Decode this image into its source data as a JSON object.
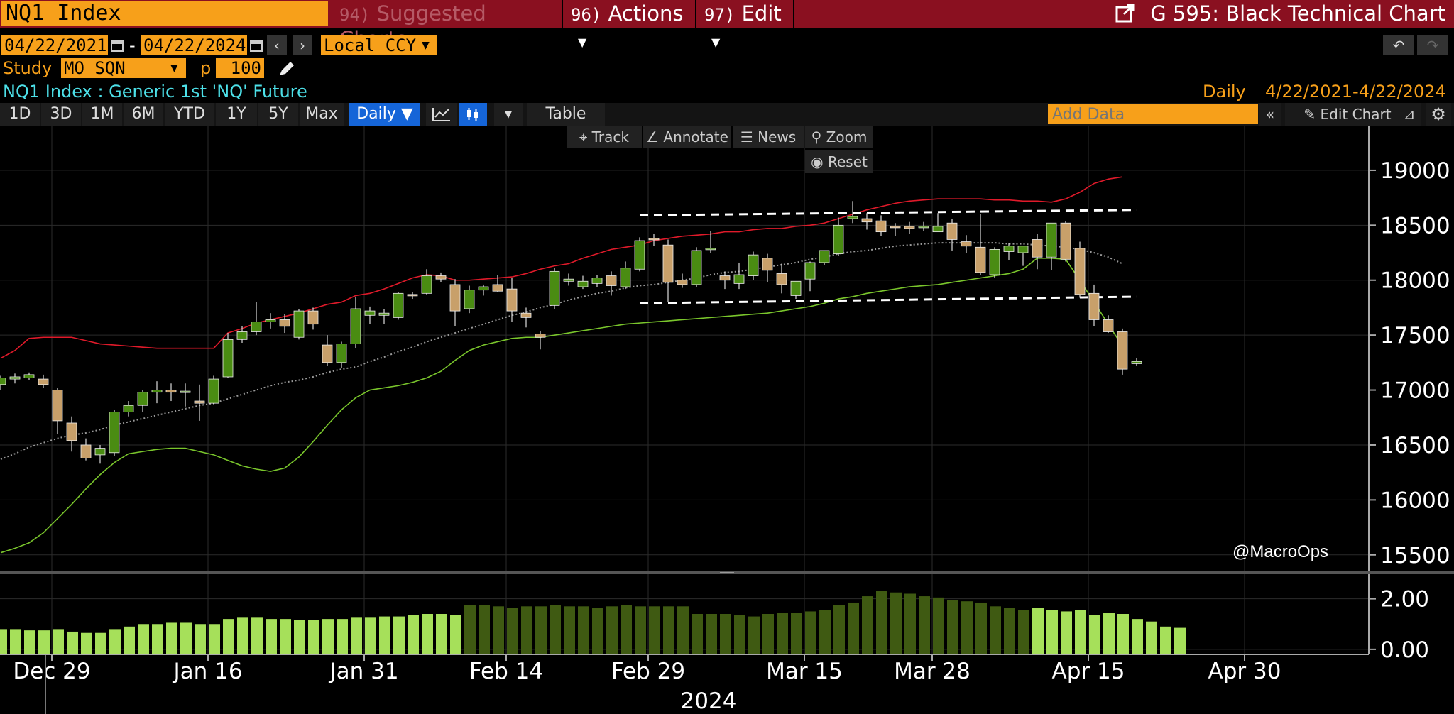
{
  "header": {
    "ticker_value": "NQ1 Index",
    "menu_suggested_num": "94)",
    "menu_suggested": "Suggested Charts",
    "menu_actions_num": "96)",
    "menu_actions": "Actions",
    "menu_edit_num": "97)",
    "menu_edit": "Edit",
    "chart_name": "G 595: Black Technical Chart"
  },
  "range": {
    "start": "04/22/2021",
    "dash": "-",
    "end": "04/22/2024",
    "currency": "Local CCY"
  },
  "study": {
    "label": "Study",
    "value": "MO SQN",
    "p_label": "p",
    "p_value": "100"
  },
  "security": {
    "desc": "NQ1 Index : Generic 1st 'NQ' Future",
    "freq": "Daily",
    "dates": "4/22/2021-4/22/2024"
  },
  "toolbar": {
    "periods": [
      "1D",
      "3D",
      "1M",
      "6M",
      "YTD",
      "1Y",
      "5Y",
      "Max"
    ],
    "frequency": "Daily ▼",
    "table": "Table",
    "add_data_placeholder": "Add Data",
    "edit_chart": "Edit Chart"
  },
  "chart_tools": {
    "track": "Track",
    "annotate": "Annotate",
    "news": "News",
    "zoom": "Zoom",
    "reset": "Reset"
  },
  "watermark": "@MacroOps",
  "colors": {
    "up": "#4a8c12",
    "down": "#c8a06a",
    "upper_band": "#e01a2a",
    "lower_band": "#7ac62c",
    "midline": "#9a9a9a",
    "volume_bright": "#a6e05a",
    "volume_dark": "#3f5a12",
    "accent": "#f7a01a",
    "bar": "#8a1020"
  },
  "chart_data": {
    "type": "candlestick",
    "price_axis": {
      "ylim": [
        15350,
        19400
      ],
      "ticks": [
        15500,
        16000,
        16500,
        17000,
        17500,
        18000,
        18500,
        19000
      ]
    },
    "sqn_axis": {
      "ylim": [
        -0.2,
        3.0
      ],
      "ticks": [
        "0.00",
        "2.00"
      ],
      "tick_values": [
        0,
        2
      ]
    },
    "x_ticks": [
      {
        "label": "Dec 29",
        "index": 1
      },
      {
        "label": "Jan 16",
        "index": 12
      },
      {
        "label": "Jan 31",
        "index": 23
      },
      {
        "label": "Feb 14",
        "index": 33
      },
      {
        "label": "Feb 29",
        "index": 43
      },
      {
        "label": "Mar 15",
        "index": 54
      },
      {
        "label": "Mar 28",
        "index": 63
      },
      {
        "label": "Apr 15",
        "index": 74
      },
      {
        "label": "Apr 30",
        "index": 85
      }
    ],
    "year_label": "2024",
    "ohlc": [
      [
        17050,
        17130,
        17000,
        17110
      ],
      [
        17100,
        17150,
        17060,
        17120
      ],
      [
        17110,
        17160,
        17090,
        17140
      ],
      [
        17100,
        17140,
        17020,
        17050
      ],
      [
        17000,
        17020,
        16600,
        16720
      ],
      [
        16700,
        16760,
        16440,
        16540
      ],
      [
        16500,
        16560,
        16360,
        16380
      ],
      [
        16410,
        16500,
        16330,
        16470
      ],
      [
        16430,
        16820,
        16400,
        16800
      ],
      [
        16800,
        16900,
        16760,
        16860
      ],
      [
        16860,
        17000,
        16800,
        16980
      ],
      [
        16980,
        17080,
        16880,
        17000
      ],
      [
        17000,
        17060,
        16900,
        16980
      ],
      [
        16990,
        17060,
        16850,
        16990
      ],
      [
        16900,
        17050,
        16720,
        16880
      ],
      [
        16880,
        17130,
        16870,
        17100
      ],
      [
        17120,
        17520,
        17110,
        17460
      ],
      [
        17460,
        17580,
        17430,
        17530
      ],
      [
        17530,
        17800,
        17500,
        17620
      ],
      [
        17620,
        17700,
        17560,
        17640
      ],
      [
        17640,
        17690,
        17520,
        17580
      ],
      [
        17480,
        17740,
        17460,
        17720
      ],
      [
        17720,
        17750,
        17550,
        17600
      ],
      [
        17410,
        17500,
        17220,
        17250
      ],
      [
        17250,
        17440,
        17200,
        17420
      ],
      [
        17420,
        17850,
        17380,
        17740
      ],
      [
        17680,
        17760,
        17600,
        17720
      ],
      [
        17680,
        17740,
        17600,
        17700
      ],
      [
        17660,
        17890,
        17640,
        17880
      ],
      [
        17870,
        17890,
        17830,
        17860
      ],
      [
        17880,
        18100,
        17870,
        18040
      ],
      [
        18040,
        18070,
        17980,
        18010
      ],
      [
        17960,
        18010,
        17580,
        17720
      ],
      [
        17740,
        17950,
        17700,
        17910
      ],
      [
        17910,
        17960,
        17860,
        17940
      ],
      [
        17960,
        18050,
        17890,
        17900
      ],
      [
        17920,
        18020,
        17620,
        17720
      ],
      [
        17700,
        17750,
        17570,
        17660
      ],
      [
        17510,
        17540,
        17370,
        17480
      ],
      [
        17770,
        18110,
        17740,
        18080
      ],
      [
        17990,
        18060,
        17950,
        18010
      ],
      [
        17940,
        18040,
        17920,
        17990
      ],
      [
        17970,
        18050,
        17940,
        18020
      ],
      [
        18040,
        18080,
        17860,
        17950
      ],
      [
        17940,
        18170,
        17920,
        18110
      ],
      [
        18100,
        18390,
        18080,
        18360
      ],
      [
        18380,
        18420,
        18310,
        18370
      ],
      [
        18320,
        18370,
        17800,
        17980
      ],
      [
        18000,
        18060,
        17930,
        17960
      ],
      [
        17960,
        18300,
        17940,
        18270
      ],
      [
        18290,
        18450,
        18250,
        18290
      ],
      [
        18040,
        18080,
        17920,
        18000
      ],
      [
        17970,
        18160,
        17920,
        18050
      ],
      [
        18040,
        18260,
        18000,
        18230
      ],
      [
        18200,
        18240,
        17980,
        18090
      ],
      [
        18060,
        18150,
        17880,
        17960
      ],
      [
        17860,
        17990,
        17830,
        17990
      ],
      [
        18010,
        18170,
        17900,
        18160
      ],
      [
        18160,
        18270,
        18140,
        18270
      ],
      [
        18240,
        18570,
        18220,
        18500
      ],
      [
        18560,
        18720,
        18520,
        18580
      ],
      [
        18560,
        18610,
        18460,
        18530
      ],
      [
        18540,
        18590,
        18400,
        18440
      ],
      [
        18490,
        18520,
        18400,
        18480
      ],
      [
        18490,
        18530,
        18420,
        18470
      ],
      [
        18490,
        18530,
        18450,
        18490
      ],
      [
        18440,
        18610,
        18460,
        18490
      ],
      [
        18520,
        18560,
        18270,
        18370
      ],
      [
        18350,
        18410,
        18250,
        18310
      ],
      [
        18300,
        18600,
        18050,
        18070
      ],
      [
        18050,
        18300,
        18020,
        18280
      ],
      [
        18260,
        18340,
        18180,
        18310
      ],
      [
        18250,
        18310,
        18130,
        18310
      ],
      [
        18370,
        18420,
        18100,
        18210
      ],
      [
        18210,
        18440,
        18090,
        18520
      ],
      [
        18520,
        18540,
        18170,
        18190
      ]
    ],
    "ohlc_tail": [
      [
        18290,
        18350,
        17840,
        17870
      ],
      [
        17880,
        17960,
        17580,
        17640
      ],
      [
        17640,
        17680,
        17520,
        17530
      ],
      [
        17530,
        17560,
        17140,
        17190
      ],
      [
        17240,
        17290,
        17220,
        17260
      ]
    ],
    "upper_band": [
      17290,
      17360,
      17470,
      17480,
      17480,
      17480,
      17450,
      17420,
      17410,
      17400,
      17390,
      17380,
      17380,
      17380,
      17380,
      17380,
      17520,
      17560,
      17610,
      17640,
      17670,
      17700,
      17740,
      17780,
      17800,
      17860,
      17880,
      17920,
      17970,
      18020,
      18050,
      18040,
      18000,
      18000,
      18010,
      18020,
      18030,
      18060,
      18100,
      18130,
      18150,
      18200,
      18240,
      18280,
      18300,
      18320,
      18360,
      18380,
      18400,
      18410,
      18420,
      18440,
      18440,
      18460,
      18470,
      18470,
      18490,
      18500,
      18520,
      18560,
      18600,
      18640,
      18670,
      18700,
      18720,
      18730,
      18740,
      18740,
      18740,
      18740,
      18730,
      18730,
      18720,
      18720,
      18710,
      18740,
      18800,
      18880,
      18920,
      18940
    ],
    "mid_line": [
      16370,
      16420,
      16480,
      16520,
      16560,
      16590,
      16610,
      16640,
      16680,
      16710,
      16740,
      16770,
      16800,
      16830,
      16860,
      16880,
      16920,
      16960,
      17000,
      17040,
      17070,
      17090,
      17120,
      17160,
      17190,
      17210,
      17260,
      17300,
      17350,
      17390,
      17440,
      17480,
      17520,
      17560,
      17600,
      17640,
      17680,
      17710,
      17750,
      17780,
      17820,
      17850,
      17880,
      17900,
      17930,
      17950,
      17960,
      17980,
      18000,
      18020,
      18050,
      18070,
      18080,
      18100,
      18120,
      18140,
      18160,
      18190,
      18210,
      18240,
      18260,
      18270,
      18290,
      18310,
      18320,
      18330,
      18340,
      18340,
      18340,
      18340,
      18340,
      18330,
      18330,
      18320,
      18310,
      18300,
      18280,
      18250,
      18210,
      18150
    ],
    "lower_band": [
      15520,
      15560,
      15610,
      15700,
      15830,
      15960,
      16100,
      16230,
      16340,
      16420,
      16440,
      16460,
      16470,
      16470,
      16440,
      16410,
      16360,
      16310,
      16280,
      16260,
      16290,
      16390,
      16530,
      16680,
      16820,
      16930,
      17000,
      17020,
      17040,
      17070,
      17110,
      17170,
      17270,
      17360,
      17410,
      17440,
      17470,
      17480,
      17480,
      17500,
      17520,
      17540,
      17560,
      17580,
      17600,
      17610,
      17620,
      17630,
      17640,
      17650,
      17660,
      17670,
      17680,
      17690,
      17700,
      17720,
      17740,
      17760,
      17790,
      17830,
      17850,
      17880,
      17900,
      17920,
      17940,
      17950,
      17960,
      17980,
      18000,
      18020,
      18040,
      18060,
      18100,
      18200,
      18200,
      18190,
      18000,
      17800,
      17600,
      17400
    ],
    "sqn": [
      0.8,
      0.8,
      0.75,
      0.75,
      0.8,
      0.7,
      0.65,
      0.65,
      0.8,
      0.9,
      1.0,
      1.0,
      1.05,
      1.05,
      1.0,
      1.0,
      1.2,
      1.25,
      1.25,
      1.2,
      1.2,
      1.15,
      1.15,
      1.2,
      1.2,
      1.25,
      1.25,
      1.3,
      1.3,
      1.35,
      1.4,
      1.4,
      1.35,
      1.75,
      1.75,
      1.7,
      1.65,
      1.7,
      1.7,
      1.75,
      1.7,
      1.7,
      1.65,
      1.7,
      1.75,
      1.7,
      1.7,
      1.7,
      1.7,
      1.4,
      1.4,
      1.4,
      1.35,
      1.3,
      1.4,
      1.45,
      1.45,
      1.5,
      1.55,
      1.75,
      1.85,
      2.1,
      2.3,
      2.25,
      2.2,
      2.1,
      2.05,
      1.95,
      1.9,
      1.85,
      1.7,
      1.65,
      1.55,
      1.65,
      1.55,
      1.5,
      1.55,
      1.35,
      1.45,
      1.4,
      1.2,
      1.1,
      0.9,
      0.85
    ]
  }
}
